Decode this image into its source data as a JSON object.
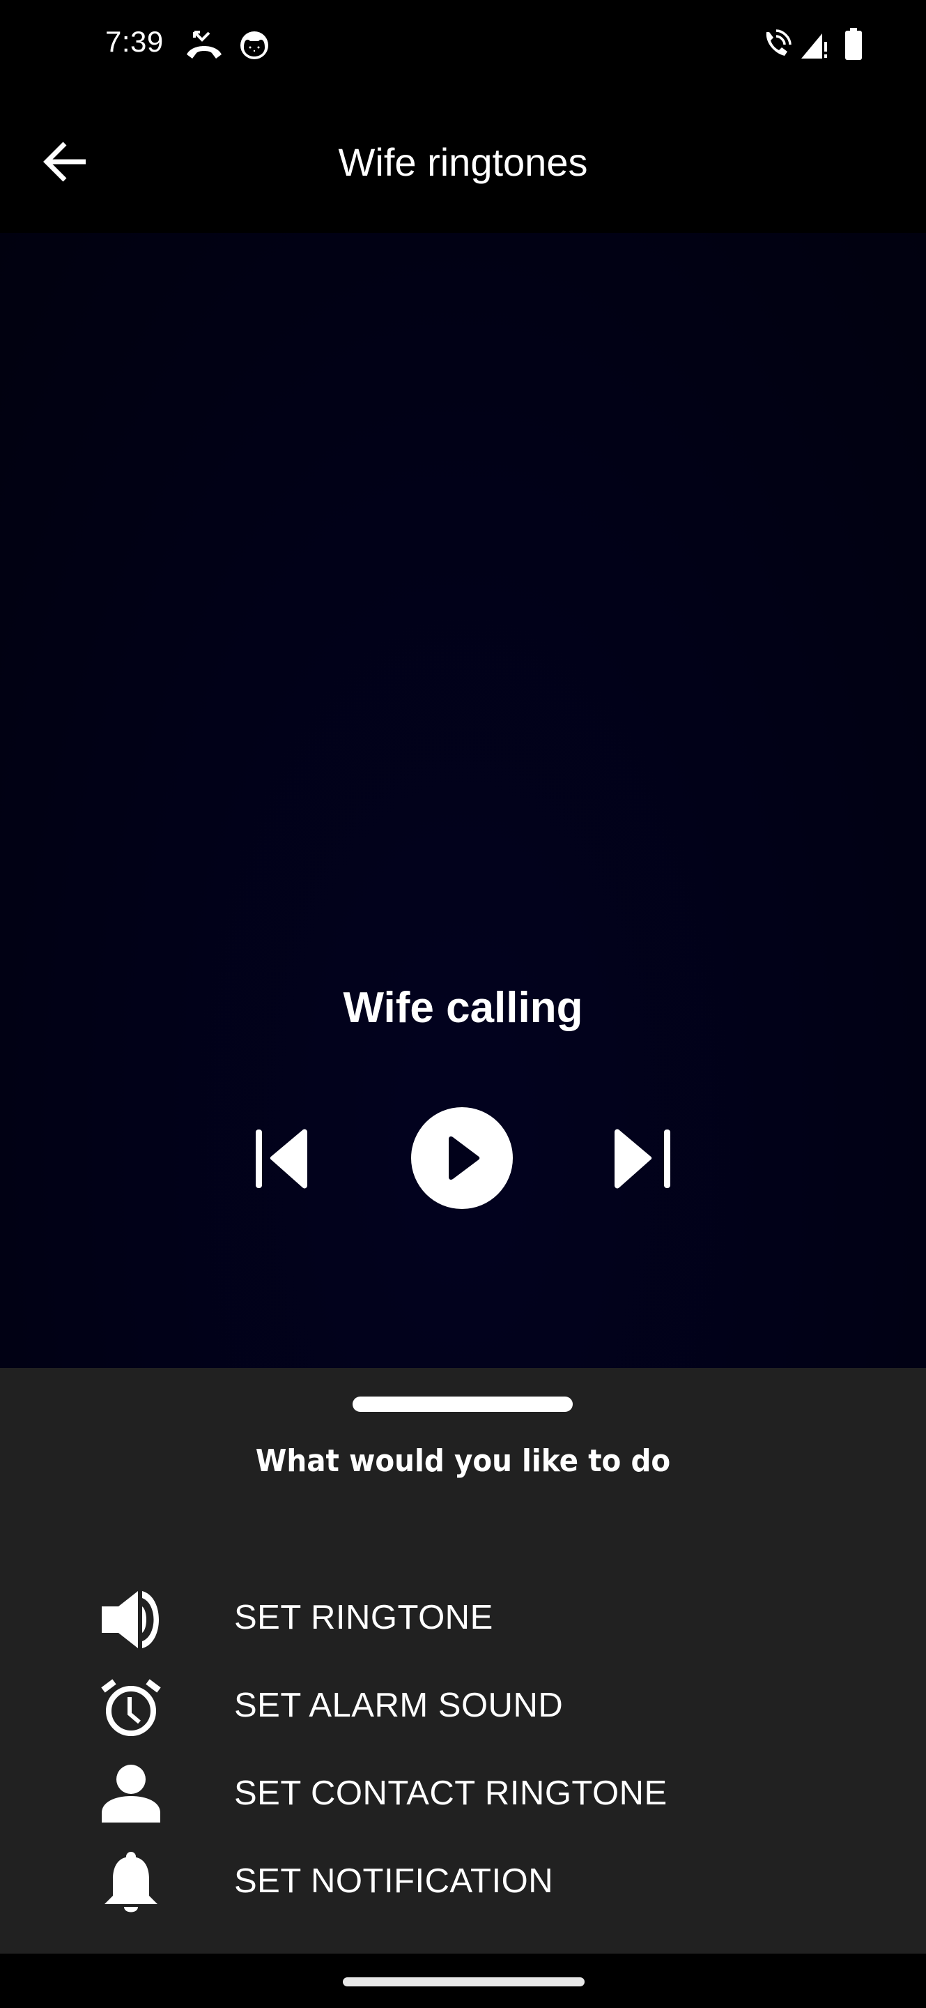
{
  "status_bar": {
    "time": "7:39",
    "left_icons": [
      "missed-call-icon",
      "cat-face-icon"
    ],
    "right_icons": [
      "wifi-calling-icon",
      "signal-alert-icon",
      "battery-icon"
    ]
  },
  "app_bar": {
    "back_icon": "arrow-left-icon",
    "title": "Wife ringtones"
  },
  "player": {
    "track_title": "Wife calling",
    "controls": [
      "skip-previous-icon",
      "play-icon",
      "skip-next-icon"
    ],
    "state": "paused"
  },
  "sheet": {
    "title": "What would you like to do",
    "actions": [
      {
        "icon": "speaker-icon",
        "label": "SET RINGTONE"
      },
      {
        "icon": "alarm-clock-icon",
        "label": "SET ALARM SOUND"
      },
      {
        "icon": "person-icon",
        "label": "SET CONTACT RINGTONE"
      },
      {
        "icon": "bell-icon",
        "label": "SET NOTIFICATION"
      }
    ]
  },
  "colors": {
    "status_bg": "#000000",
    "player_bg": "#01011a",
    "sheet_bg": "#212121",
    "foreground": "#ffffff"
  }
}
